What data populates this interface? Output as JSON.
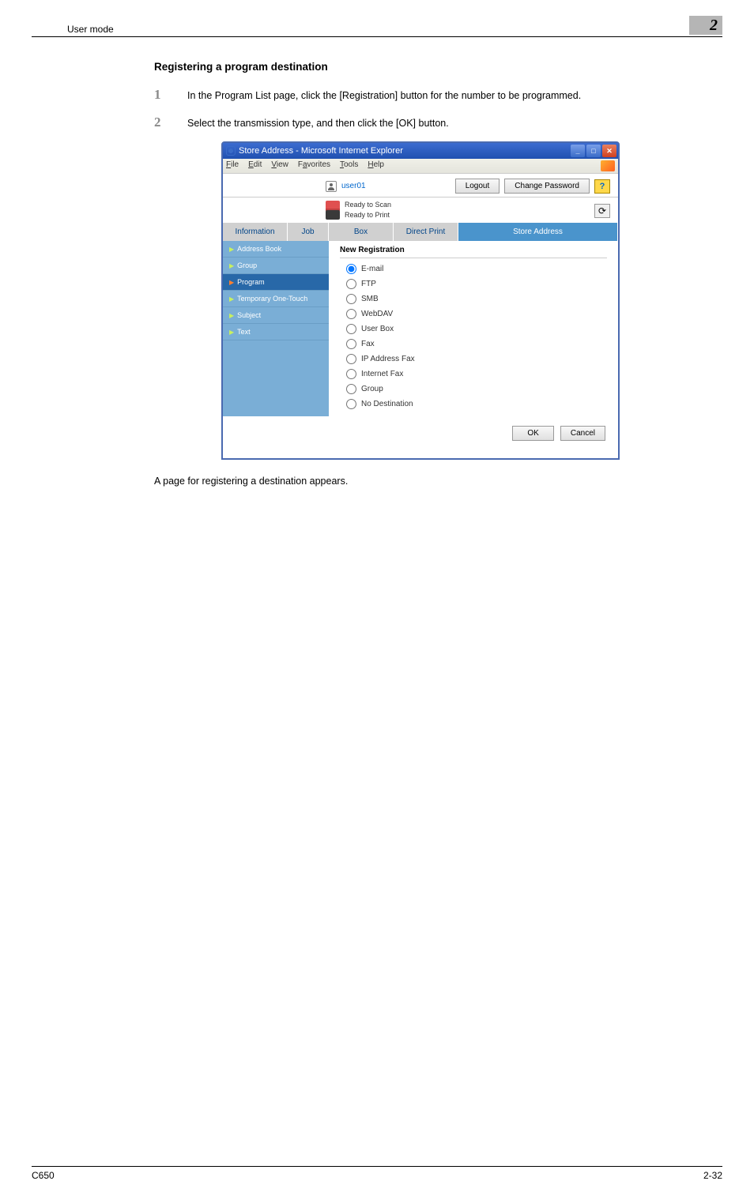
{
  "doc": {
    "header_left": "User mode",
    "header_right": "2",
    "section_title": "Registering a program destination",
    "steps": [
      {
        "num": "1",
        "text": "In the Program List page, click the [Registration] button for the number to be programmed."
      },
      {
        "num": "2",
        "text": "Select the transmission type, and then click the [OK] button."
      }
    ],
    "footer_note": "A page for registering a destination appears.",
    "footer_left": "C650",
    "footer_right": "2-32"
  },
  "browser": {
    "title": "Store Address - Microsoft Internet Explorer",
    "menu": [
      "File",
      "Edit",
      "View",
      "Favorites",
      "Tools",
      "Help"
    ],
    "user": "user01",
    "logout": "Logout",
    "change_password": "Change Password",
    "status_scan": "Ready to Scan",
    "status_print": "Ready to Print",
    "tabs": [
      "Information",
      "Job",
      "Box",
      "Direct Print",
      "Store Address"
    ],
    "sidebar": [
      "Address Book",
      "Group",
      "Program",
      "Temporary One-Touch",
      "Subject",
      "Text"
    ],
    "form_title": "New Registration",
    "radios": [
      "E-mail",
      "FTP",
      "SMB",
      "WebDAV",
      "User Box",
      "Fax",
      "IP Address Fax",
      "Internet Fax",
      "Group",
      "No Destination"
    ],
    "ok": "OK",
    "cancel": "Cancel"
  }
}
